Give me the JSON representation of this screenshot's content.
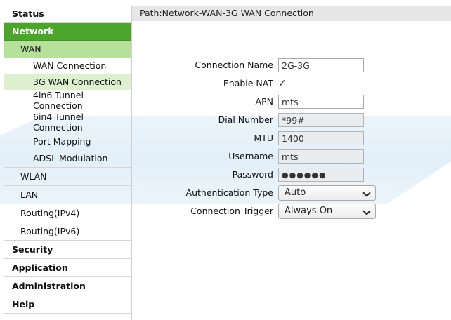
{
  "path": "Path:Network-WAN-3G WAN Connection",
  "sidebar": {
    "status": "Status",
    "network": "Network",
    "wan": "WAN",
    "wan_items": {
      "wan_connection": "WAN Connection",
      "wan3g": "3G WAN Connection",
      "tunnel_4in6_a": "4in6 Tunnel",
      "tunnel_4in6_b": "Connection",
      "tunnel_6in4_a": "6in4 Tunnel",
      "tunnel_6in4_b": "Connection",
      "port_mapping": "Port Mapping",
      "adsl": "ADSL Modulation"
    },
    "wlan": "WLAN",
    "lan": "LAN",
    "routing_v4": "Routing(IPv4)",
    "routing_v6": "Routing(IPv6)",
    "security": "Security",
    "application": "Application",
    "administration": "Administration",
    "help": "Help"
  },
  "form": {
    "connection_name": {
      "label": "Connection Name",
      "value": "2G-3G"
    },
    "enable_nat": {
      "label": "Enable NAT",
      "checked": "✓"
    },
    "apn": {
      "label": "APN",
      "value": "mts"
    },
    "dial_number": {
      "label": "Dial Number",
      "value": "*99#"
    },
    "mtu": {
      "label": "MTU",
      "value": "1400"
    },
    "username": {
      "label": "Username",
      "value": "mts"
    },
    "password": {
      "label": "Password",
      "value": "●●●●●●"
    },
    "auth_type": {
      "label": "Authentication Type",
      "value": "Auto"
    },
    "conn_trigger": {
      "label": "Connection Trigger",
      "value": "Always On"
    }
  },
  "colors": {
    "nav_active": "#4aa52a",
    "sub_active": "#b6e19a",
    "leaf_active": "#dff0d0"
  }
}
